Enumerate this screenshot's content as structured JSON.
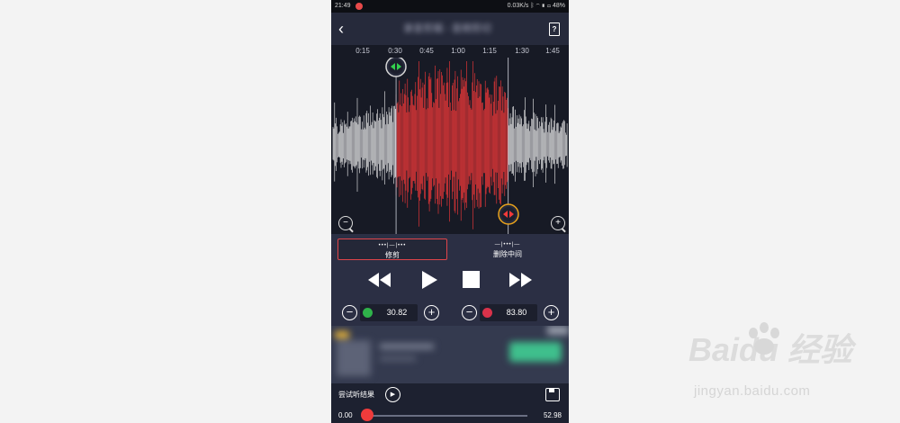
{
  "status_bar": {
    "time": "21:49",
    "network": "0.03K/s",
    "battery": "48%"
  },
  "header": {
    "title": "录音剪辑 - 音频剪切"
  },
  "timeline": {
    "ticks": [
      "0:15",
      "0:30",
      "0:45",
      "1:00",
      "1:15",
      "1:30",
      "1:45"
    ]
  },
  "selection": {
    "start_fraction": 0.273,
    "end_fraction": 0.745
  },
  "modes": [
    {
      "label": "修剪",
      "icon": "•••|—|•••",
      "active": true
    },
    {
      "label": "删除中间",
      "icon": "—|•••|—",
      "active": false
    }
  ],
  "transport": {
    "rewind": "rewind-icon",
    "play": "play-icon",
    "stop": "stop-icon",
    "forward": "fast-forward-icon"
  },
  "start_time": {
    "minus": "−",
    "plus": "+",
    "value": "30.82",
    "color": "#2fb34a"
  },
  "end_time": {
    "minus": "−",
    "plus": "+",
    "value": "83.80",
    "color": "#d9324a"
  },
  "result": {
    "label": "尝试听结果",
    "progress_start": "0.00",
    "progress_end": "52.98",
    "progress_fraction": 0.0
  },
  "colors": {
    "wave_selected": "#ff3a3a",
    "wave_unselected": "#f2f2f2",
    "accent": "#e0454a"
  },
  "watermark": {
    "logo": "Baidu 经验",
    "url": "jingyan.baidu.com"
  }
}
